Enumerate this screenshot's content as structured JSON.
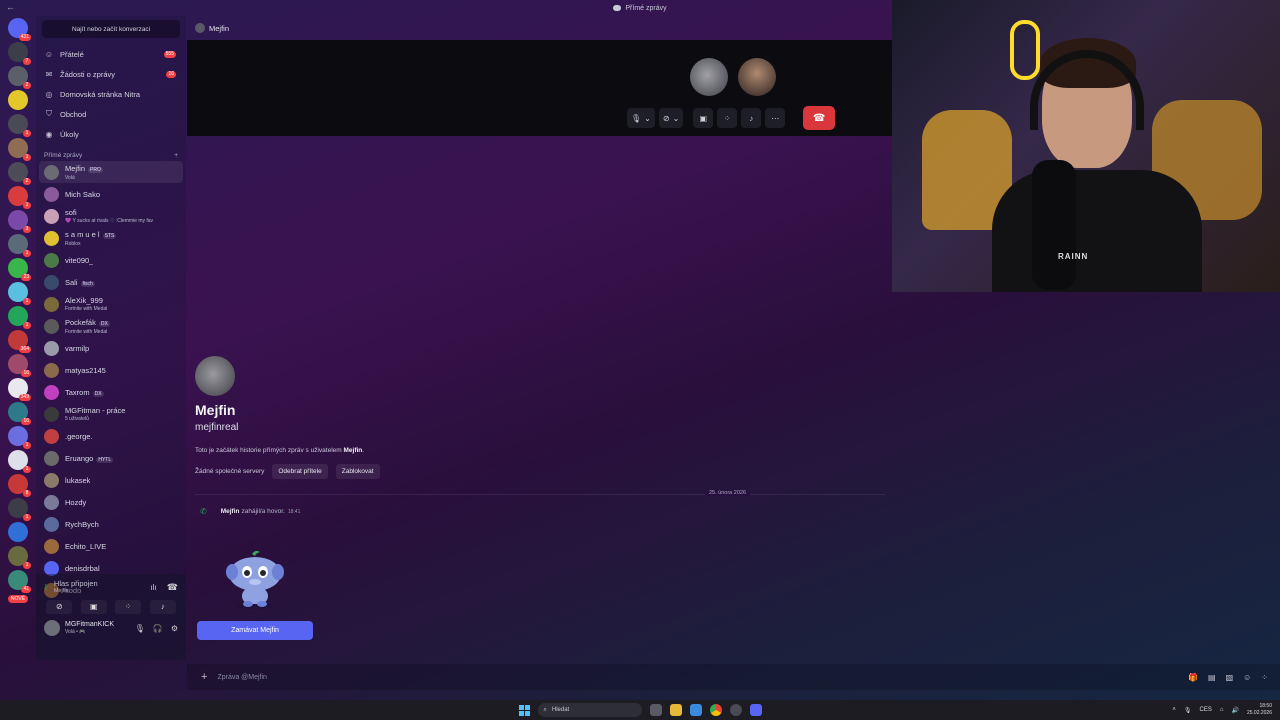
{
  "titlebar": {
    "title": "Přímé zprávy"
  },
  "rail": {
    "servers": [
      {
        "color": "#5865f2",
        "badge": "431"
      },
      {
        "color": "#3c3e4a",
        "badge": "7"
      },
      {
        "color": "#5a5f6a",
        "badge": "2"
      },
      {
        "color": "#e2c82a",
        "badge": ""
      },
      {
        "color": "#4a4a56",
        "badge": "1"
      },
      {
        "color": "#8e6d52",
        "badge": "1"
      },
      {
        "color": "#4c4c58",
        "badge": "2"
      },
      {
        "color": "#d83c3e",
        "badge": "1"
      },
      {
        "color": "#7a4aa8",
        "badge": "3"
      },
      {
        "color": "#5a6a78",
        "badge": "1"
      },
      {
        "color": "#39b54a",
        "badge": "23"
      },
      {
        "color": "#5bc0e0",
        "badge": "1"
      },
      {
        "color": "#23a55a",
        "badge": "1"
      },
      {
        "color": "#c03a3a",
        "badge": "364"
      },
      {
        "color": "#a04a6a",
        "badge": "16"
      },
      {
        "color": "#e8e8ee",
        "badge": "349"
      },
      {
        "color": "#2d7a8a",
        "badge": "16"
      },
      {
        "color": "#6b6ee0",
        "badge": "1"
      },
      {
        "color": "#dde0ea",
        "badge": "1"
      },
      {
        "color": "#c73838",
        "badge": "8"
      },
      {
        "color": "#3d3d48",
        "badge": "1"
      },
      {
        "color": "#2f6fd6",
        "badge": ""
      },
      {
        "color": "#6a6a40",
        "badge": "1"
      },
      {
        "color": "#3a8a7a",
        "badge": "41"
      }
    ],
    "new_label": "NOVÉ"
  },
  "sidebar": {
    "search_label": "Najít nebo začít konverzaci",
    "nav": [
      {
        "label": "Přátelé",
        "icon": "friends-icon",
        "count": "555"
      },
      {
        "label": "Žádosti o zprávy",
        "icon": "mail-icon",
        "count": "16"
      },
      {
        "label": "Domovská stránka Nitra",
        "icon": "nitro-icon",
        "count": ""
      },
      {
        "label": "Obchod",
        "icon": "shop-icon",
        "count": ""
      },
      {
        "label": "Úkoly",
        "icon": "tasks-icon",
        "count": ""
      }
    ],
    "dm_header": "Přímé zprávy",
    "dm_add": "+",
    "dms": [
      {
        "name": "Mejfin",
        "tag": "PRO",
        "status": "Volá",
        "color": "#6b6b74"
      },
      {
        "name": "Mich Sako",
        "tag": "",
        "status": "",
        "color": "#8a5a9a"
      },
      {
        "name": "sofi",
        "tag": "",
        "status": "💜 Y sucks at rivals ♡ :Clemmie my fav",
        "color": "#c8a0b8"
      },
      {
        "name": "s a m u e l",
        "tag": "STS",
        "status": "Roblox",
        "color": "#e0c030"
      },
      {
        "name": "vite090_",
        "tag": "",
        "status": "",
        "color": "#4a7a4a"
      },
      {
        "name": "Sali",
        "tag": "fisch",
        "status": "",
        "color": "#3a4a6a"
      },
      {
        "name": "AleXik_999",
        "tag": "",
        "status": "Fortnite with Medal",
        "color": "#7a6a3a"
      },
      {
        "name": "Pockefák",
        "tag": "DX",
        "status": "Fortnite with Medal",
        "color": "#5a5a5a"
      },
      {
        "name": "varmilp",
        "tag": "",
        "status": "",
        "color": "#9a9aaa"
      },
      {
        "name": "matyas2145",
        "tag": "",
        "status": "",
        "color": "#8a6a4a"
      },
      {
        "name": "Taxrom",
        "tag": "DX",
        "status": "",
        "color": "#c040c0"
      },
      {
        "name": "MGFitman - práce",
        "tag": "",
        "status": "5 uživatelů",
        "color": "#3a3a3a"
      },
      {
        "name": ".george.",
        "tag": "",
        "status": "",
        "color": "#c04040"
      },
      {
        "name": "Eruango",
        "tag": "HYTL",
        "status": "",
        "color": "#6a6a6a"
      },
      {
        "name": "lukasek",
        "tag": "",
        "status": "",
        "color": "#8a7a6a"
      },
      {
        "name": "Hozdy",
        "tag": "",
        "status": "",
        "color": "#7a7a9a"
      },
      {
        "name": "RychBych",
        "tag": "",
        "status": "",
        "color": "#5a6a9a"
      },
      {
        "name": "Echito_LIVE",
        "tag": "",
        "status": "",
        "color": "#9a6a3a"
      },
      {
        "name": "denisdrbal",
        "tag": "",
        "status": "",
        "color": "#5865f2"
      },
      {
        "name": "kodo",
        "tag": "",
        "status": "",
        "color": "#c07a3a"
      }
    ],
    "voice": {
      "title": "Hlas připojen",
      "channel": "Mejfin"
    },
    "user": {
      "name": "MGFitmanKICK",
      "status": "Volá • 🎮"
    }
  },
  "main": {
    "header_name": "Mejfin",
    "profile": {
      "display_name": "Mejfin",
      "username": "mejfinreal",
      "intro_prefix": "Toto je začátek historie přímých zpráv s uživatelem ",
      "intro_name": "Mejfin",
      "intro_suffix": ".",
      "no_servers": "Žádné společné servery",
      "remove_friend": "Odebrat přítele",
      "block": "Zablokovat"
    },
    "date_divider": "25. února 2026",
    "call_message": {
      "author": "Mejfin",
      "text": "zahájil/a hovor.",
      "time": "18:41"
    },
    "wave_button": "Zamávat Mejfin",
    "composer_placeholder": "Zpráva @Mejfin"
  },
  "webcam": {
    "shirt_text": "RAINN"
  },
  "taskbar": {
    "search": "Hledat",
    "lang": "CES",
    "time": "18:50",
    "date": "25.02.2026"
  }
}
